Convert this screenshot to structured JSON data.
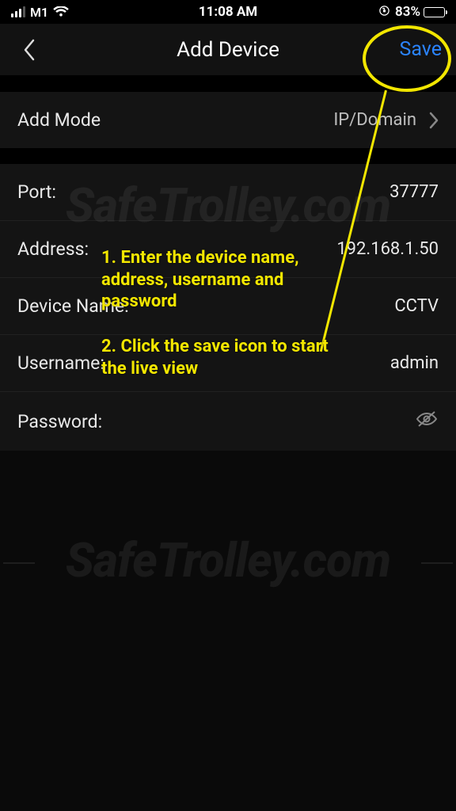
{
  "status": {
    "carrier": "M1",
    "time": "11:08 AM",
    "battery_percent": "83%"
  },
  "header": {
    "title": "Add Device",
    "save_label": "Save"
  },
  "mode": {
    "label": "Add Mode",
    "value": "IP/Domain"
  },
  "fields": {
    "port_label": "Port:",
    "port_value": "37777",
    "address_label": "Address:",
    "address_value": "192.168.1.50",
    "device_name_label": "Device Name:",
    "device_name_value": "CCTV",
    "username_label": "Username:",
    "username_value": "admin",
    "password_label": "Password:",
    "password_value": ""
  },
  "watermark": "SafeTrolley.com",
  "annotations": {
    "step1": "1. Enter the device name, address, username and password",
    "step2": "2. Click the save icon to start the live view"
  }
}
